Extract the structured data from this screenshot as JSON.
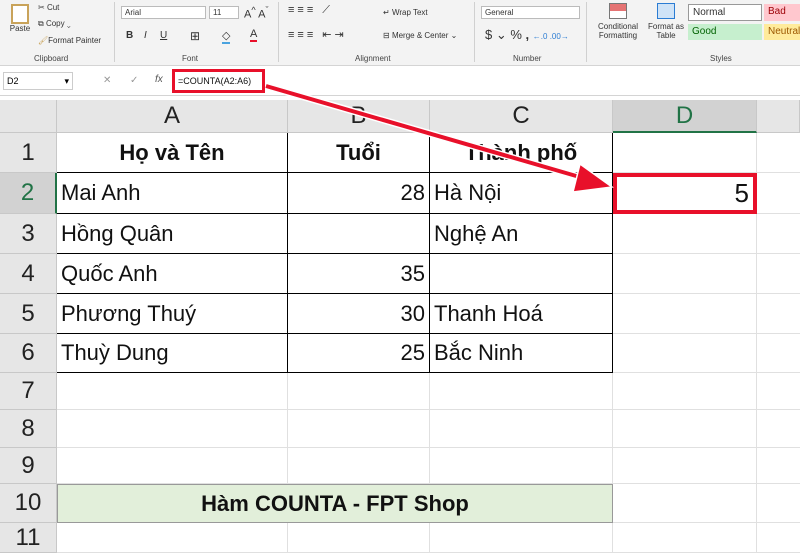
{
  "ribbon": {
    "paste": "Paste",
    "cut": "Cut",
    "copy": "Copy",
    "format_painter": "Format Painter",
    "clipboard": "Clipboard",
    "font_name": "Arial",
    "font_size": "11",
    "bold": "B",
    "italic": "I",
    "underline": "U",
    "font": "Font",
    "wrap_text": "Wrap Text",
    "merge_center": "Merge & Center",
    "alignment": "Alignment",
    "number_format": "General",
    "currency": "$",
    "percent": "%",
    "comma": ",",
    "number": "Number",
    "conditional_formatting": "Conditional Formatting",
    "format_as_table": "Format as Table",
    "style_normal": "Normal",
    "style_bad": "Bad",
    "style_good": "Good",
    "style_neutral": "Neutral",
    "styles": "Styles"
  },
  "formula_bar": {
    "name_box": "D2",
    "fx": "fx",
    "formula": "=COUNTA(A2:A6)"
  },
  "columns": [
    "A",
    "B",
    "C",
    "D"
  ],
  "rows": [
    "1",
    "2",
    "3",
    "4",
    "5",
    "6",
    "7",
    "8",
    "9",
    "10",
    "11"
  ],
  "cells": {
    "A1": "Họ và Tên",
    "B1": "Tuổi",
    "C1": "Thành phố",
    "A2": "Mai Anh",
    "B2": "28",
    "C2": "Hà Nội",
    "D2": "5",
    "A3": "Hồng Quân",
    "B3": "",
    "C3": "Nghệ An",
    "A4": "Quốc Anh",
    "B4": "35",
    "C4": "",
    "A5": "Phương Thuý",
    "B5": "30",
    "C5": "Thanh Hoá",
    "A6": "Thuỳ Dung",
    "B6": "25",
    "C6": "Bắc Ninh",
    "A10": "Hàm COUNTA - FPT Shop"
  },
  "colors": {
    "highlight": "#e8102a",
    "title_fill": "#e2efda",
    "selected_header": "#d2d2d2"
  }
}
